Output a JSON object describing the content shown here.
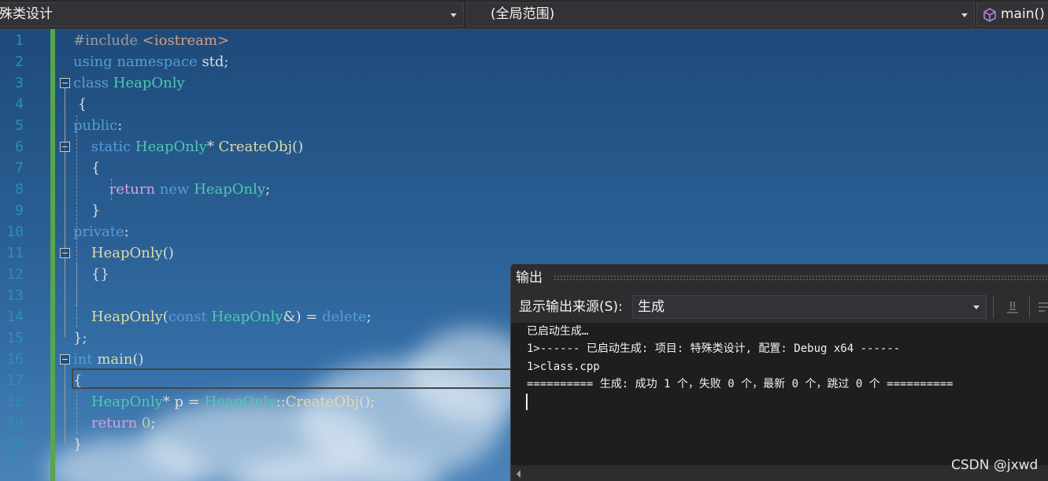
{
  "navbar": {
    "project_dropdown": "殊类设计",
    "scope_dropdown": "(全局范围)",
    "member_dropdown": "main()",
    "member_icon": "cube-icon"
  },
  "editor": {
    "line_numbers": [
      "1",
      "2",
      "3",
      "4",
      "5",
      "6",
      "7",
      "8",
      "9",
      "10",
      "11",
      "12",
      "13",
      "14",
      "15",
      "16",
      "17",
      "18",
      "19",
      "20",
      "21"
    ],
    "code_tokens": [
      [
        [
          "pp",
          "#include "
        ],
        [
          "s",
          "<iostream>"
        ]
      ],
      [
        [
          "k",
          "using"
        ],
        [
          "p",
          " "
        ],
        [
          "k",
          "namespace"
        ],
        [
          "p",
          " std;"
        ]
      ],
      [
        [
          "k",
          "class"
        ],
        [
          "p",
          " "
        ],
        [
          "t",
          "HeapOnly"
        ]
      ],
      [
        [
          "p",
          " {"
        ]
      ],
      [
        [
          "k",
          "public"
        ],
        [
          "p",
          ":"
        ]
      ],
      [
        [
          "p",
          "    "
        ],
        [
          "k",
          "static"
        ],
        [
          "p",
          " "
        ],
        [
          "t",
          "HeapOnly"
        ],
        [
          "p",
          "* "
        ],
        [
          "f",
          "CreateObj"
        ],
        [
          "p",
          "()"
        ]
      ],
      [
        [
          "p",
          "    {"
        ]
      ],
      [
        [
          "p",
          "        "
        ],
        [
          "c",
          "return"
        ],
        [
          "p",
          " "
        ],
        [
          "k",
          "new"
        ],
        [
          "p",
          " "
        ],
        [
          "t",
          "HeapOnly"
        ],
        [
          "p",
          ";"
        ]
      ],
      [
        [
          "p",
          "    }"
        ]
      ],
      [
        [
          "k",
          "private"
        ],
        [
          "p",
          ":"
        ]
      ],
      [
        [
          "p",
          "    "
        ],
        [
          "f",
          "HeapOnly"
        ],
        [
          "p",
          "()"
        ]
      ],
      [
        [
          "p",
          "    {}"
        ]
      ],
      [
        [
          "p",
          ""
        ]
      ],
      [
        [
          "p",
          "    "
        ],
        [
          "f",
          "HeapOnly"
        ],
        [
          "p",
          "("
        ],
        [
          "k",
          "const"
        ],
        [
          "p",
          " "
        ],
        [
          "t",
          "HeapOnly"
        ],
        [
          "p",
          "&) = "
        ],
        [
          "k",
          "delete"
        ],
        [
          "p",
          ";"
        ]
      ],
      [
        [
          "p",
          "};"
        ]
      ],
      [
        [
          "k",
          "int"
        ],
        [
          "p",
          " "
        ],
        [
          "f",
          "main"
        ],
        [
          "p",
          "()"
        ]
      ],
      [
        [
          "p",
          "{"
        ]
      ],
      [
        [
          "p",
          "    "
        ],
        [
          "t",
          "HeapOnly"
        ],
        [
          "p",
          "* "
        ],
        [
          "p",
          "p"
        ],
        [
          "p",
          " = "
        ],
        [
          "t",
          "HeapOnly"
        ],
        [
          "p",
          "::"
        ],
        [
          "f",
          "CreateObj"
        ],
        [
          "p",
          "();"
        ]
      ],
      [
        [
          "p",
          "    "
        ],
        [
          "c",
          "return"
        ],
        [
          "p",
          " "
        ],
        [
          "n",
          "0"
        ],
        [
          "p",
          ";"
        ]
      ],
      [
        [
          "p",
          "}"
        ]
      ],
      [
        [
          "p",
          ""
        ]
      ]
    ]
  },
  "output_panel": {
    "title": "输出",
    "source_label": "显示输出来源(S):",
    "source_value": "生成",
    "lines": [
      "已启动生成…",
      "1>------ 已启动生成: 项目: 特殊类设计, 配置: Debug x64 ------",
      "1>class.cpp",
      "========== 生成: 成功 1 个，失败 0 个，最新 0 个，跳过 0 个 =========="
    ]
  },
  "watermark": "CSDN @jxwd"
}
